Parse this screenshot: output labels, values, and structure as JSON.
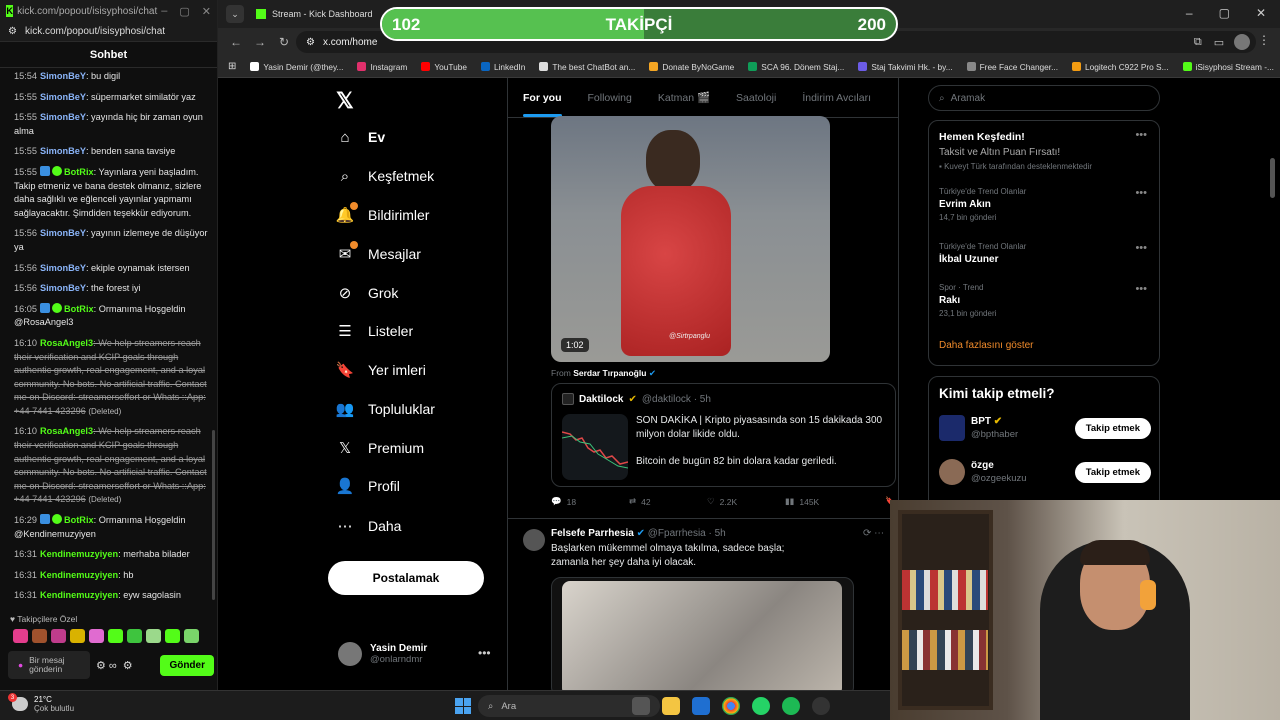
{
  "kick": {
    "window_title": "kick.com/popout/isisyphosi/chat",
    "url": "kick.com/popout/isisyphosi/chat",
    "heading": "Sohbet",
    "messages": [
      {
        "time": "15:54",
        "user": "SimonBeY",
        "user_color": "#8ab4f8",
        "text": ": bu digil"
      },
      {
        "time": "15:55",
        "user": "SimonBeY",
        "user_color": "#8ab4f8",
        "text": ": süpermarket similatör yaz"
      },
      {
        "time": "15:55",
        "user": "SimonBeY",
        "user_color": "#8ab4f8",
        "text": ": yayında hiç bir zaman oyun alma"
      },
      {
        "time": "15:55",
        "user": "SimonBeY",
        "user_color": "#8ab4f8",
        "text": ": benden sana tavsiye"
      },
      {
        "time": "15:55",
        "user": "BotRix",
        "user_color": "#53fc18",
        "text": ": Yayınlara yeni başladım. Takip etmeniz ve bana destek olmanız, sizlere daha sağlıklı ve eğlenceli yayınlar yapmamı sağlayacaktır. Şimdiden teşekkür ediyorum."
      },
      {
        "time": "15:56",
        "user": "SimonBeY",
        "user_color": "#8ab4f8",
        "text": ": yayının izlemeye de düşüyor ya"
      },
      {
        "time": "15:56",
        "user": "SimonBeY",
        "user_color": "#8ab4f8",
        "text": ": ekiple oynamak istersen"
      },
      {
        "time": "15:56",
        "user": "SimonBeY",
        "user_color": "#8ab4f8",
        "text": ": the forest iyi"
      },
      {
        "time": "16:05",
        "user": "BotRix",
        "user_color": "#53fc18",
        "text": ": Ormanıma Hoşgeldin @RosaAngel3"
      },
      {
        "time": "16:10",
        "user": "RosaAngel3",
        "user_color": "#53fc18",
        "text": ": We help streamers reach their verification and KCIP goals through authentic growth, real engagement, and a loyal community. No bots. No artificial traffic. Contact me on Discord: streamerseffort or Whats ::App: +44 7441 423296",
        "deleted": "(Deleted)"
      },
      {
        "time": "16:10",
        "user": "RosaAngel3",
        "user_color": "#53fc18",
        "text": ": We help streamers reach their verification and KCIP goals through authentic growth, real engagement, and a loyal community. No bots. No artificial traffic. Contact me on Discord: streamerseffort or Whats ::App: +44 7441 423296",
        "deleted": "(Deleted)"
      },
      {
        "time": "16:29",
        "user": "BotRix",
        "user_color": "#53fc18",
        "text": ": Ormanıma Hoşgeldin @Kendinemuzyiyen"
      },
      {
        "time": "16:31",
        "user": "Kendinemuzyiyen",
        "user_color": "#53fc18",
        "text": ": merhaba bilader"
      },
      {
        "time": "16:31",
        "user": "Kendinemuzyiyen",
        "user_color": "#53fc18",
        "text": ": hb"
      },
      {
        "time": "16:31",
        "user": "Kendinemuzyiyen",
        "user_color": "#53fc18",
        "text": ": eyw sagolasin"
      }
    ],
    "followers_only_label": "Takipçilere Özel",
    "input_placeholder": "Bir mesaj gönderin",
    "send_label": "Gönder"
  },
  "browser": {
    "tab_title": "Stream - Kick Dashboard",
    "url": "x.com/home",
    "bookmarks": [
      {
        "label": "Yasin Demir (@they...",
        "color": "#fff"
      },
      {
        "label": "Instagram",
        "color": "#e1306c"
      },
      {
        "label": "YouTube",
        "color": "#ff0000"
      },
      {
        "label": "LinkedIn",
        "color": "#0a66c2"
      },
      {
        "label": "The best ChatBot an...",
        "color": "#ddd"
      },
      {
        "label": "Donate ByNoGame",
        "color": "#f5a623"
      },
      {
        "label": "SCA 96. Dönem Staj...",
        "color": "#0f9d58"
      },
      {
        "label": "Staj Takvimi Hk. - by...",
        "color": "#6c5ce7"
      },
      {
        "label": "Free Face Changer...",
        "color": "#888"
      },
      {
        "label": "Logitech C922 Pro S...",
        "color": "#f39c12"
      },
      {
        "label": "iSisyphosi Stream -...",
        "color": "#53fc18"
      }
    ]
  },
  "follower_goal": {
    "current": "102",
    "label": "TAKİPÇİ",
    "goal": "200",
    "progress": 0.51
  },
  "x": {
    "nav": [
      {
        "label": "Ev",
        "icon": "home-icon",
        "glyph": "⌂",
        "bold": true
      },
      {
        "label": "Keşfetmek",
        "icon": "search-icon",
        "glyph": "⌕"
      },
      {
        "label": "Bildirimler",
        "icon": "bell-icon",
        "glyph": "🔔",
        "dot": true
      },
      {
        "label": "Mesajlar",
        "icon": "mail-icon",
        "glyph": "✉",
        "dot": true
      },
      {
        "label": "Grok",
        "icon": "grok-icon",
        "glyph": "⊘"
      },
      {
        "label": "Listeler",
        "icon": "list-icon",
        "glyph": "☰"
      },
      {
        "label": "Yer imleri",
        "icon": "bookmark-icon",
        "glyph": "🔖"
      },
      {
        "label": "Topluluklar",
        "icon": "communities-icon",
        "glyph": "👥"
      },
      {
        "label": "Premium",
        "icon": "x-premium-icon",
        "glyph": "𝕏"
      },
      {
        "label": "Profil",
        "icon": "profile-icon",
        "glyph": "👤"
      },
      {
        "label": "Daha",
        "icon": "more-circle-icon",
        "glyph": "⋯"
      }
    ],
    "post_button": "Postalamak",
    "account": {
      "name": "Yasin Demir",
      "handle": "@onlarndmr"
    },
    "feed_tabs": [
      "For you",
      "Following",
      "Katman 🎬",
      "Saatoloji",
      "İndirim Avcıları"
    ],
    "video_duration": "1:02",
    "video_watermark": "@Sirtrpanglu",
    "from_label": "From",
    "from_name": "Serdar Tırpanoğlu",
    "quote": {
      "name": "Daktilock",
      "handle": "@daktilock · 5h",
      "text1": "SON DAKİKA | Kripto piyasasında son 15 dakikada 300 milyon dolar likide oldu.",
      "text2": "Bitcoin de bugün 82 bin dolara kadar geriledi."
    },
    "actions": {
      "replies": "18",
      "reposts": "42",
      "likes": "2.2K",
      "views": "145K"
    },
    "post2": {
      "name": "Felsefe Parrhesia",
      "handle": "@Fparrhesia · 5h",
      "text": "Başlarken mükemmel olmaya takılma, sadece başla; zamanla her şey daha iyi olacak."
    },
    "search_placeholder": "Aramak",
    "ad": {
      "title": "Hemen Keşfedin!",
      "subtitle": "Taksit ve Altın Puan Fırsatı!",
      "sponsor": "Kuveyt Türk tarafından desteklenmektedir"
    },
    "trends": [
      {
        "category": "Türkiye'de Trend Olanlar",
        "name": "Evrim Akın",
        "count": "14,7 bin gönderi"
      },
      {
        "category": "Türkiye'de Trend Olanlar",
        "name": "İkbal Uzuner",
        "count": ""
      },
      {
        "category": "Spor · Trend",
        "name": "Rakı",
        "count": "23,1 bin gönderi"
      }
    ],
    "show_more": "Daha fazlasını göster",
    "who_to_follow": "Kimi takip etmeli?",
    "suggestions": [
      {
        "name": "BPT",
        "handle": "@bpthaber",
        "button": "Takip etmek"
      },
      {
        "name": "özge",
        "handle": "@ozgeekuzu",
        "button": "Takip etmek"
      }
    ]
  },
  "taskbar": {
    "temperature": "21°C",
    "weather": "Çok bulutlu",
    "notif_count": "3",
    "search_placeholder": "Ara"
  }
}
